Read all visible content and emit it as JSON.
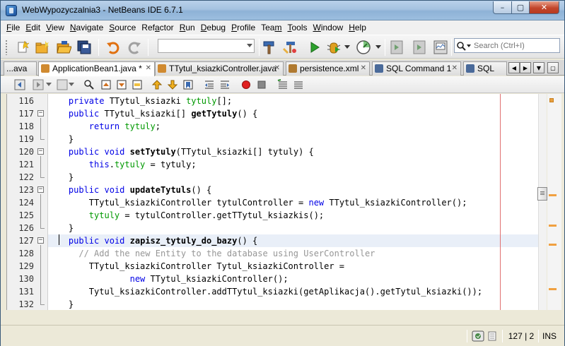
{
  "window": {
    "title": "WebWypozyczalnia3 - NetBeans IDE 6.7.1",
    "buttons": {
      "minimize": "–",
      "maximize": "▢",
      "close": "✕"
    }
  },
  "menubar": {
    "items": [
      {
        "u": "F",
        "rest": "ile"
      },
      {
        "u": "E",
        "rest": "dit"
      },
      {
        "u": "V",
        "rest": "iew"
      },
      {
        "u": "N",
        "rest": "avigate"
      },
      {
        "u": "S",
        "rest": "ource"
      },
      {
        "pre": "Ref",
        "u": "a",
        "rest": "ctor"
      },
      {
        "u": "R",
        "rest": "un"
      },
      {
        "u": "D",
        "rest": "ebug"
      },
      {
        "u": "P",
        "rest": "rofile"
      },
      {
        "pre": "Tea",
        "u": "m",
        "rest": ""
      },
      {
        "u": "T",
        "rest": "ools"
      },
      {
        "u": "W",
        "rest": "indow"
      },
      {
        "u": "H",
        "rest": "elp"
      }
    ]
  },
  "toolbar": {
    "configuration_value": "",
    "search_placeholder": "Search (Ctrl+I)"
  },
  "tabs": [
    {
      "label": "...ava",
      "icon_color": "",
      "close": ""
    },
    {
      "label": "ApplicationBean1.java *",
      "icon_color": "#d08a30",
      "close": "✕",
      "active": true
    },
    {
      "label": "TTytul_ksiazkiController.java",
      "icon_color": "#d08a30",
      "close": "✕"
    },
    {
      "label": "persistence.xml",
      "icon_color": "#b07a30",
      "close": "✕"
    },
    {
      "label": "SQL Command 1",
      "icon_color": "#4a6a9a",
      "close": "✕"
    },
    {
      "label": "SQL",
      "icon_color": "#4a6a9a",
      "close": ""
    }
  ],
  "tab_nav": {
    "left": "◀",
    "right": "▶",
    "list": "▼",
    "restore": "▢"
  },
  "editor": {
    "lines": [
      {
        "num": "116",
        "fold": "",
        "segments": [
          [
            "",
            "    "
          ],
          [
            "kw",
            "private"
          ],
          [
            "",
            " TTytul_ksiazki "
          ],
          [
            "fld",
            "tytuly"
          ],
          [
            "",
            "[];"
          ]
        ]
      },
      {
        "num": "117",
        "fold": "-",
        "segments": [
          [
            "",
            "    "
          ],
          [
            "kw",
            "public"
          ],
          [
            "",
            " TTytul_ksiazki[] "
          ],
          [
            "mt",
            "getTytuly"
          ],
          [
            "",
            "() {"
          ]
        ]
      },
      {
        "num": "118",
        "fold": "",
        "segments": [
          [
            "",
            "        "
          ],
          [
            "kw",
            "return"
          ],
          [
            "",
            " "
          ],
          [
            "fld",
            "tytuly"
          ],
          [
            "",
            ";"
          ]
        ]
      },
      {
        "num": "119",
        "fold": "end",
        "segments": [
          [
            "",
            "    }"
          ]
        ]
      },
      {
        "num": "120",
        "fold": "-",
        "segments": [
          [
            "",
            "    "
          ],
          [
            "kw",
            "public"
          ],
          [
            "",
            " "
          ],
          [
            "kw",
            "void"
          ],
          [
            "",
            " "
          ],
          [
            "mt",
            "setTytuly"
          ],
          [
            "",
            "(TTytul_ksiazki[] tytuly) {"
          ]
        ]
      },
      {
        "num": "121",
        "fold": "",
        "segments": [
          [
            "",
            "        "
          ],
          [
            "kw",
            "this"
          ],
          [
            "",
            "."
          ],
          [
            "fld",
            "tytuly"
          ],
          [
            "",
            " = tytuly;"
          ]
        ]
      },
      {
        "num": "122",
        "fold": "end",
        "segments": [
          [
            "",
            "    }"
          ]
        ]
      },
      {
        "num": "123",
        "fold": "-",
        "segments": [
          [
            "",
            "    "
          ],
          [
            "kw",
            "public"
          ],
          [
            "",
            " "
          ],
          [
            "kw",
            "void"
          ],
          [
            "",
            " "
          ],
          [
            "mt",
            "updateTytuls"
          ],
          [
            "",
            "() {"
          ]
        ]
      },
      {
        "num": "124",
        "fold": "",
        "segments": [
          [
            "",
            "        TTytul_ksiazkiController tytulController = "
          ],
          [
            "kw",
            "new"
          ],
          [
            "",
            " TTytul_ksiazkiController();"
          ]
        ]
      },
      {
        "num": "125",
        "fold": "",
        "segments": [
          [
            "",
            "        "
          ],
          [
            "fld",
            "tytuly"
          ],
          [
            "",
            " = tytulController.getTTytul_ksiazkis();"
          ]
        ]
      },
      {
        "num": "126",
        "fold": "end",
        "segments": [
          [
            "",
            "    }"
          ]
        ]
      },
      {
        "num": "127",
        "fold": "-",
        "current": true,
        "segments": [
          [
            "",
            "    "
          ],
          [
            "kw",
            "public"
          ],
          [
            "",
            " "
          ],
          [
            "kw",
            "void"
          ],
          [
            "",
            " "
          ],
          [
            "mt",
            "zapisz_tytuly_do_bazy"
          ],
          [
            "",
            "() {"
          ]
        ]
      },
      {
        "num": "128",
        "fold": "",
        "segments": [
          [
            "",
            "      "
          ],
          [
            "cm",
            "// Add the new Entity to the database using UserController"
          ]
        ]
      },
      {
        "num": "129",
        "fold": "",
        "segments": [
          [
            "",
            "        TTytul_ksiazkiController Tytul_ksiazkiController ="
          ]
        ]
      },
      {
        "num": "130",
        "fold": "",
        "segments": [
          [
            "",
            "                "
          ],
          [
            "kw",
            "new"
          ],
          [
            "",
            " TTytul_ksiazkiController();"
          ]
        ]
      },
      {
        "num": "131",
        "fold": "",
        "segments": [
          [
            "",
            "        Tytul_ksiazkiController.addTTytul_ksiazki(getAplikacja().getTytul_ksiazki());"
          ]
        ]
      },
      {
        "num": "132",
        "fold": "end",
        "segments": [
          [
            "",
            "    }"
          ]
        ]
      }
    ]
  },
  "status": {
    "position": "127 | 2",
    "mode": "INS"
  }
}
